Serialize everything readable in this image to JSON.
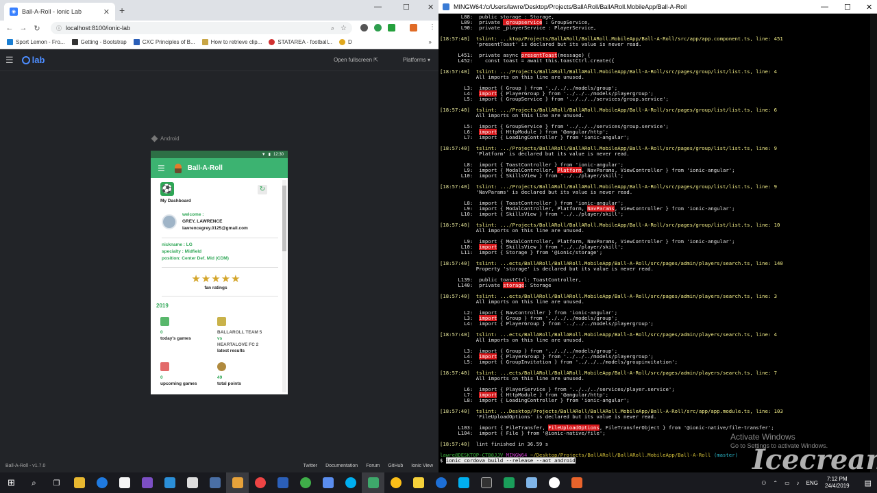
{
  "browser": {
    "tab_title": "Ball-A-Roll - Ionic Lab",
    "url": "localhost:8100/ionic-lab",
    "bookmarks": [
      "Sport Lemon - Fro...",
      "Getting - Bootstrap",
      "CXC Principles of B...",
      "How to retrieve clip...",
      "STATAREA - football...",
      "D"
    ]
  },
  "lab": {
    "logo_text": "lab",
    "open_fullscreen": "Open fullscreen",
    "platforms": "Platforms",
    "platform_label": "Android",
    "footer_version": "Ball-A-Roll - v1.7.0",
    "footer_links": [
      "Twitter",
      "Documentation",
      "Forum",
      "GitHub",
      "Ionic View"
    ]
  },
  "app": {
    "status_time": "12:30",
    "title": "Ball-A-Roll",
    "dashboard_label": "My Dashboard",
    "welcome": "welcome :",
    "user_name": "GREY, LAWRENCE",
    "user_email": "lawrencegrey.0125@gmail.com",
    "nickname": "nickname : LG",
    "specialty": "specialty : Midfield",
    "position": "position: Center Def. Mid (CDM)",
    "rating_stars": 5,
    "fan_ratings": "fan ratings",
    "year": "2019",
    "todays_games_count": "0",
    "todays_games_label": "today's games",
    "team1": "BALLAROLL TEAM 5",
    "vs": "vs",
    "team2": "HEARTALOVE FC 2",
    "latest_results": "latest results",
    "upcoming_count": "0",
    "upcoming_label": "upcoming games",
    "points_count": "49",
    "points_label": "total points"
  },
  "terminal": {
    "title": "MINGW64:/c/Users/lawre/Desktop/Projects/BallARoll/BallARoll.MobileApp/Ball-A-Roll",
    "lint_finished": "lint finished in 36.59 s",
    "prompt_user": "lawre@DESKTOP-CTB8JJV",
    "prompt_host": "MINGW64",
    "prompt_path": "~/Desktop/Projects/BallARoll/BallARoll.MobileApp/Ball-A-Roll",
    "prompt_branch": "(master)",
    "command": "ionic cordova build --release --aot android"
  },
  "watermark": {
    "line1": "Activate Windows",
    "line2": "Go to Settings to activate Windows.",
    "brand": "Icecream"
  },
  "taskbar": {
    "lang": "ENG",
    "time": "7:12 PM",
    "date": "24/4/2019"
  }
}
